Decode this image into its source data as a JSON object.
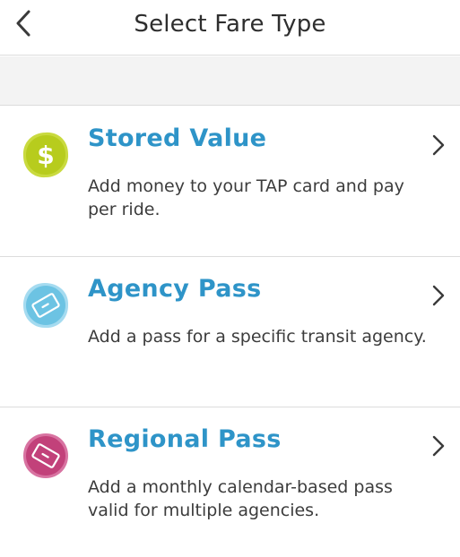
{
  "header": {
    "title": "Select Fare Type",
    "back_icon": "chevron-left-icon"
  },
  "fare_types": [
    {
      "title": "Stored Value",
      "description": "Add money to your TAP card and pay per ride.",
      "icon": "dollar-icon",
      "icon_color": "#c3d62a"
    },
    {
      "title": "Agency Pass",
      "description": "Add a pass for a specific transit agency.",
      "icon": "ticket-icon",
      "icon_color": "#6cc3e3"
    },
    {
      "title": "Regional Pass",
      "description": "Add a monthly calendar-based pass valid for multiple agencies.",
      "icon": "ticket-icon",
      "icon_color": "#c2417a"
    }
  ],
  "colors": {
    "title_accent": "#2e94c8",
    "divider": "#dcdcdc",
    "band": "#f3f3f3"
  }
}
